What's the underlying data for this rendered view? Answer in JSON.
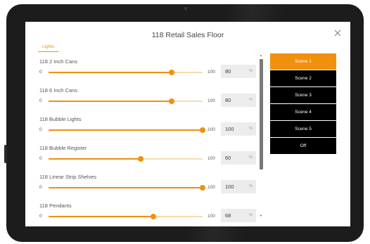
{
  "dialog": {
    "title": "118 Retail Sales Floor"
  },
  "tabs": [
    {
      "label": "Lights",
      "active": true
    }
  ],
  "devices": [
    {
      "name": "118 2 Inch Cans",
      "min": "0",
      "max": "100",
      "value": "80",
      "unit": "%",
      "level": 0.8
    },
    {
      "name": "118 6 Inch Cans",
      "min": "0",
      "max": "100",
      "value": "80",
      "unit": "%",
      "level": 0.8
    },
    {
      "name": "118 Bubble Lights",
      "min": "0",
      "max": "100",
      "value": "100",
      "unit": "%",
      "level": 1.0
    },
    {
      "name": "118 Bubble Register",
      "min": "0",
      "max": "100",
      "value": "60",
      "unit": "%",
      "level": 0.6
    },
    {
      "name": "118 Linear Strip Shelves",
      "min": "0",
      "max": "100",
      "value": "100",
      "unit": "%",
      "level": 1.0
    },
    {
      "name": "118 Pendants",
      "min": "0",
      "max": "100",
      "value": "68",
      "unit": "%",
      "level": 0.68
    }
  ],
  "scenes": [
    {
      "label": "Scene 1",
      "active": true
    },
    {
      "label": "Scene 2",
      "active": false
    },
    {
      "label": "Scene 3",
      "active": false
    },
    {
      "label": "Scene 4",
      "active": false
    },
    {
      "label": "Scene 5",
      "active": false
    },
    {
      "label": "Off",
      "active": false
    }
  ],
  "colors": {
    "accent": "#f0900c",
    "scene_bg": "#000000",
    "field_bg": "#ececec"
  },
  "icons": {
    "close": "close-icon",
    "scroll_up": "caret-up-icon",
    "scroll_down": "caret-down-icon"
  }
}
